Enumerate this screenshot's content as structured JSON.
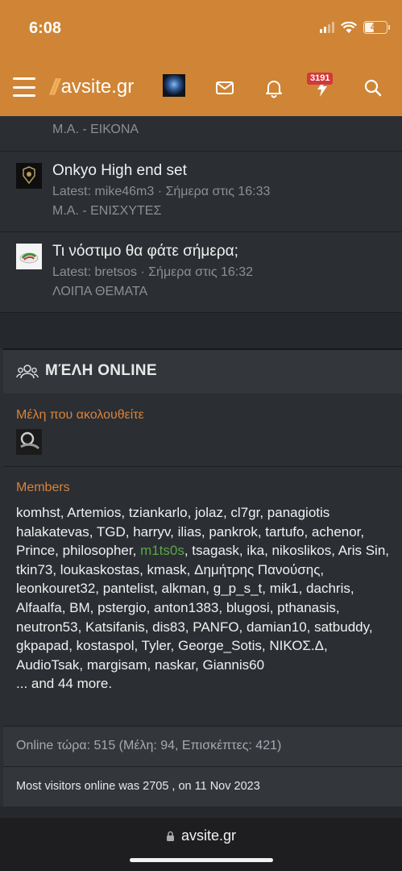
{
  "status_bar": {
    "time": "6:08",
    "battery": "41",
    "battery_fraction": 0.41
  },
  "navbar": {
    "logo_text": "avsite.gr",
    "alerts_badge": "3191"
  },
  "threads": [
    {
      "forum": "Μ.Α. - ΕΙΚΟΝΑ"
    },
    {
      "title": "Onkyo High end set",
      "meta": "Latest: mike46m3 · Σήμερα στις 16:33",
      "forum": "Μ.Α. - ΕΝΙΣΧΥΤΕΣ"
    },
    {
      "title": "Τι νόστιμο θα φάτε σήμερα;",
      "meta": "Latest: bretsos · Σήμερα στις 16:32",
      "forum": "ΛΟΙΠΑ ΘΕΜΑΤΑ"
    }
  ],
  "online": {
    "title": "ΜΈΛΗ ONLINE",
    "following_label": "Μέλη που ακολουθείτε",
    "members_label": "Members",
    "members_before": "komhst, Artemios, tziankarlo, jolaz, cl7gr, panagiotis halakatevas, TGD, harryv, ilias, pankrok, tartufo, achenor, Prince, philosopher,",
    "members_highlight": "m1ts0s",
    "members_after": ", tsagask, ika, nikoslikos, Aris Sin, tkin73, loukaskostas, kmask, Δημήτρης Πανούσης, leonkouret32, pantelist, alkman, g_p_s_t, mik1, dachris, Alfaalfa, BM, pstergio, anton1383, blugosi, pthanasis, neutron53, Katsifanis, dis83, PANFO, damian10, satbuddy, gkpapad, kostaspol, Tyler, George_Sotis, ΝΙΚΟΣ.Δ, AudioTsak, margisam, naskar, Giannis60",
    "more": "... and 44 more.",
    "now_online": "Online τώρα: 515 (Μέλη: 94, Επισκέπτες: 421)",
    "record": "Most visitors online was 2705 , on 11 Nov 2023"
  },
  "browser": {
    "url": "avsite.gr"
  }
}
